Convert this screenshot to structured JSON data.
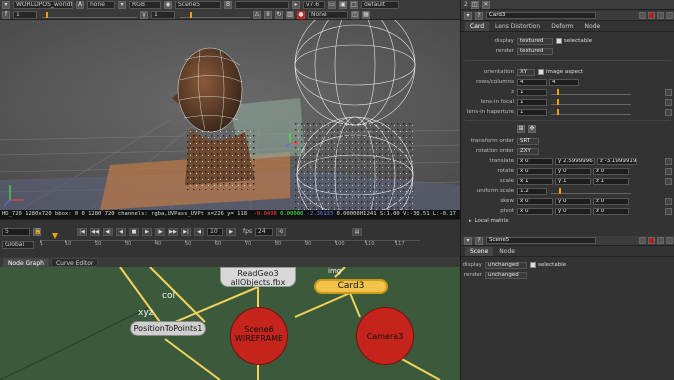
{
  "viewer": {
    "toolbar_row1": {
      "path_field": "WORLDPOS_worldfinal18513700",
      "channels": "none",
      "colorspace": "RGB",
      "scene": "Scene5",
      "zoom": "v7.6",
      "lut": "default"
    },
    "toolbar_row2": {
      "frame": "1",
      "mode": "1",
      "display": "None",
      "gain": "1"
    },
    "info_bar": {
      "format": "HD_720  1280x720 bbox: 0 0 1280 720 channels: rgba,UVPass_UVPt  x=226 y= 118",
      "r": "-0.0498",
      "g": "0.00000",
      "b": "-2.36133",
      "a": "0.00000",
      "extra": "1",
      "right": "H:241 S:1.00 V:-30.51  L:-0.17"
    }
  },
  "timeline": {
    "frame_field": "5",
    "fps_label": "fps",
    "fps_value": "24",
    "range_start": "1",
    "range_end": "10",
    "global_label": "Global",
    "ticks": [
      "1",
      "10",
      "20",
      "30",
      "40",
      "50",
      "60",
      "70",
      "80",
      "90",
      "100",
      "110",
      "117"
    ]
  },
  "node_graph": {
    "tabs": [
      "Node Graph",
      "Curve Editor"
    ],
    "nodes": {
      "readgeo": {
        "line1": "ReadGeo3",
        "line2": "allObjects.fbx"
      },
      "card": "Card3",
      "position": "PositionToPoints1",
      "scene": {
        "line1": "Scene6",
        "line2": "WIREFRAME"
      },
      "camera": "Camera3"
    },
    "pipe_labels": {
      "col": "col",
      "xyz": "xyz",
      "img": "img"
    }
  },
  "properties": {
    "card": {
      "name": "Card3",
      "tabs": [
        "Card",
        "Lens Distortion",
        "Deform",
        "Node"
      ],
      "display_label": "display",
      "display_value": "textured",
      "selectable_label": "selectable",
      "render_label": "render",
      "render_value": "textured",
      "orientation_label": "orientation",
      "orientation_value": "XY",
      "image_aspect_label": "image aspect",
      "rows_label": "rows/columns",
      "rows_value": "4",
      "columns_value": "4",
      "z_label": "z",
      "z_value": "1",
      "focal_label": "lens-in focal",
      "focal_value": "1",
      "haperture_label": "lens-in haperture",
      "haperture_value": "1",
      "transform_order_label": "transform order",
      "transform_order_value": "SRT",
      "rotation_order_label": "rotation order",
      "rotation_order_value": "ZXY",
      "translate_label": "translate",
      "translate": [
        "x 0",
        "y 2.59999967",
        "z -3.19999194"
      ],
      "rotate_label": "rotate",
      "rotate": [
        "x 0",
        "y 0",
        "z 0"
      ],
      "scale_label": "scale",
      "scale": [
        "x 1",
        "y 1",
        "z 1"
      ],
      "uniform_scale_label": "uniform scale",
      "uniform_scale_value": "1.2",
      "skew_label": "skew",
      "skew": [
        "x 0",
        "y 0",
        "z 0"
      ],
      "pivot_label": "pivot",
      "pivot": [
        "x 0",
        "y 0",
        "z 0"
      ],
      "local_matrix_label": "Local matrix"
    },
    "scene": {
      "name": "Scene5",
      "tabs": [
        "Scene",
        "Node"
      ],
      "display_label": "display",
      "display_value": "unchanged",
      "selectable_label": "selectable",
      "render_label": "render",
      "render_value": "unchanged"
    },
    "header_number": "2",
    "header_number2": "1"
  },
  "colors": {
    "node_red": "#c4241c",
    "node_yellow_outline": "#f2c24a",
    "pipe": "#f2d25a",
    "graph_bg": "#3b5a3b",
    "accent_orange": "#f0a000"
  }
}
